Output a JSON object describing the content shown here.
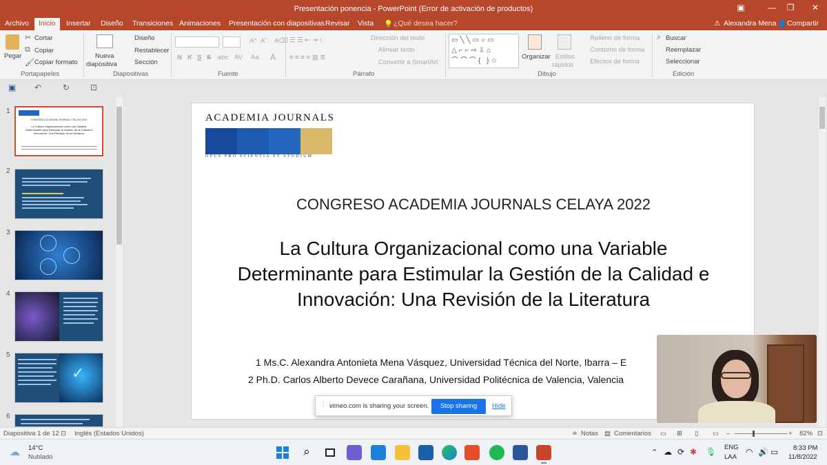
{
  "window": {
    "title": "Presentación ponencia - PowerPoint (Error de activación de productos)",
    "restore_icon": "restore-icon",
    "minimize_icon": "minimize-icon",
    "maximize_icon": "maximize-icon",
    "close_icon": "close-icon"
  },
  "menu": {
    "tabs": [
      "Archivo",
      "Inicio",
      "Insertar",
      "Diseño",
      "Transiciones",
      "Animaciones",
      "Presentación con diapositivas",
      "Revisar",
      "Vista"
    ],
    "active_tab": "Inicio",
    "tell_me": "¿Qué desea hacer?",
    "user": "Alexandra Mena",
    "share": "Compartir"
  },
  "ribbon": {
    "clipboard": {
      "paste": "Pegar",
      "cut": "Cortar",
      "copy": "Copiar",
      "format_painter": "Copiar formato",
      "label": "Portapapeles"
    },
    "slides": {
      "new_slide_line1": "Nueva",
      "new_slide_line2": "diapositiva",
      "layout": "Diseño",
      "reset": "Restablecer",
      "section": "Sección",
      "label": "Diapositivas"
    },
    "font": {
      "bold": "N",
      "italic": "K",
      "underline": "S",
      "strike": "S",
      "shadow": "abc",
      "spacing": "AV",
      "case": "Aa",
      "color": "A",
      "label": "Fuente"
    },
    "paragraph": {
      "text_direction": "Dirección del texto",
      "align_text": "Alinear texto",
      "smartart": "Convertir a SmartArt",
      "label": "Párrafo"
    },
    "drawing": {
      "arrange": "Organizar",
      "quick_styles_line1": "Estilos",
      "quick_styles_line2": "rápidos",
      "shape_fill": "Relleno de forma",
      "shape_outline": "Contorno de forma",
      "shape_effects": "Efectos de forma",
      "label": "Dibujo"
    },
    "editing": {
      "find": "Buscar",
      "replace": "Reemplazar",
      "select": "Seleccionar",
      "label": "Edición"
    }
  },
  "thumbnails": [
    {
      "num": "1",
      "kind": "title",
      "selected": true,
      "heading": "CONGRESO ACADEMIA JOURNALS CELAYA 2022",
      "body": "La Cultura Organizacional como una Variable Determinante para Estimular la Gestión de la Calidad e Innovación: Una Revisión de la Literatura"
    },
    {
      "num": "2",
      "kind": "blue-text",
      "selected": false
    },
    {
      "num": "3",
      "kind": "network",
      "selected": false
    },
    {
      "num": "4",
      "kind": "hand",
      "selected": false
    },
    {
      "num": "5",
      "kind": "checkmark",
      "selected": false
    },
    {
      "num": "6",
      "kind": "blue-text",
      "selected": false
    }
  ],
  "slide": {
    "logo_text": "ACADEMIA JOURNALS",
    "logo_motto": "OPUS PRO SCIENTIA ET STUDIUM",
    "logo_colors": [
      "#174a9c",
      "#1d5bb0",
      "#2566c0",
      "#d8b86a"
    ],
    "congress": "CONGRESO ACADEMIA JOURNALS CELAYA 2022",
    "title_lines": [
      "La Cultura Organizacional como una Variable",
      "Determinante para Estimular la Gestión de la Calidad e",
      "Innovación: Una Revisión de la Literatura"
    ],
    "authors": [
      "1 Ms.C. Alexandra Antonieta Mena Vásquez, Universidad Técnica del Norte, Ibarra – E",
      "2 Ph.D. Carlos Alberto Devece Carañana, Universidad Politécnica de Valencia, Valencia"
    ]
  },
  "status": {
    "slide_info": "Diapositiva 1 de 12",
    "language": "Inglés (Estados Unidos)",
    "notes": "Notas",
    "comments": "Comentarios",
    "zoom": "82%",
    "zoom_minus": "–",
    "zoom_plus": "+"
  },
  "share_bar": {
    "message": "vimeo.com is sharing your screen.",
    "stop": "Stop sharing",
    "hide": "Hide"
  },
  "taskbar": {
    "weather_temp": "14°C",
    "weather_desc": "Nublado",
    "lang_line1": "ENG",
    "lang_line2": "LAA",
    "time": "8:33 PM",
    "date": "11/8/2022",
    "apps": [
      "windows-start",
      "search",
      "task-view",
      "teams-chat",
      "mail",
      "file-explorer",
      "store",
      "edge",
      "office",
      "spotify",
      "word",
      "powerpoint"
    ]
  },
  "colors": {
    "accent": "#b7472a",
    "ribbon_bg": "#f3f3f3",
    "thumb_blue": "#1f4e79",
    "share_button": "#1a73e8"
  }
}
